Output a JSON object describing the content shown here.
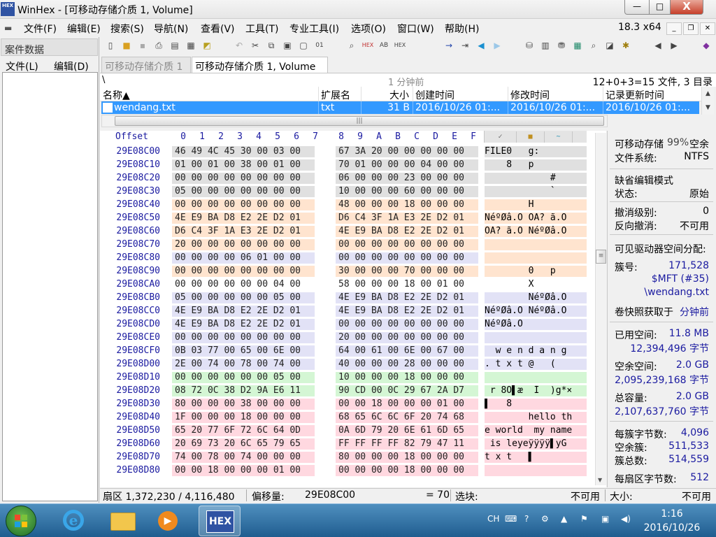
{
  "window": {
    "title": "WinHex - [可移动存储介质 1, Volume]",
    "app_logo": "HEX",
    "btn_min": "—",
    "btn_max": "□",
    "btn_close": "X"
  },
  "menu": {
    "items": [
      "文件(F)",
      "编辑(E)",
      "搜索(S)",
      "导航(N)",
      "查看(V)",
      "工具(T)",
      "专业工具(I)",
      "选项(O)",
      "窗口(W)",
      "帮助(H)"
    ],
    "version": "18.3 x64",
    "mdi_min": "_",
    "mdi_restore": "❐",
    "mdi_close": "✕"
  },
  "case_panel": {
    "title": "案件数据",
    "menu_file": "文件(L)",
    "menu_edit": "编辑(D)"
  },
  "tabs": [
    {
      "label": "可移动存储介质 1"
    },
    {
      "label": "可移动存储介质 1, Volume"
    }
  ],
  "pathbar": {
    "path": "\\",
    "time": "1 分钟前",
    "stats": "12+0+3=15 文件, 3 目录"
  },
  "file_columns": [
    "名称▲",
    "扩展名",
    "大小",
    "创建时间",
    "修改时间",
    "记录更新时间"
  ],
  "file_rows": [
    {
      "name": "wendang.txt",
      "ext": "txt",
      "size": "31 B",
      "created": "2016/10/26  01:...",
      "modified": "2016/10/26  01:...",
      "record_updated": "2016/10/26  01:..."
    }
  ],
  "hex_header": {
    "offset_label": "Offset",
    "columns": [
      "0",
      "1",
      "2",
      "3",
      "4",
      "5",
      "6",
      "7",
      "8",
      "9",
      "A",
      "B",
      "C",
      "D",
      "E",
      "F"
    ]
  },
  "hex_rows": [
    {
      "offset": "29E08C00",
      "a": "46 49 4C 45 30 00 03 00",
      "b": "67 3A 20 00 00 00 00 00",
      "text": "FILE0   g:      "
    },
    {
      "offset": "29E08C10",
      "a": "01 00 01 00 38 00 01 00",
      "b": "70 01 00 00 00 04 00 00",
      "text": "    8   p       "
    },
    {
      "offset": "29E08C20",
      "a": "00 00 00 00 00 00 00 00",
      "b": "06 00 00 00 23 00 00 00",
      "text": "            #   "
    },
    {
      "offset": "29E08C30",
      "a": "05 00 00 00 00 00 00 00",
      "b": "10 00 00 00 60 00 00 00",
      "text": "            `   "
    },
    {
      "offset": "29E08C40",
      "a": "00 00 00 00 00 00 00 00",
      "b": "48 00 00 00 18 00 00 00",
      "text": "        H       "
    },
    {
      "offset": "29E08C50",
      "a": "4E E9 BA D8 E2 2E D2 01",
      "b": "D6 C4 3F 1A E3 2E D2 01",
      "text": "NéºØâ.Ò ÖÄ? ã.Ò "
    },
    {
      "offset": "29E08C60",
      "a": "D6 C4 3F 1A E3 2E D2 01",
      "b": "4E E9 BA D8 E2 2E D2 01",
      "text": "ÖÄ? ã.Ò NéºØâ.Ò "
    },
    {
      "offset": "29E08C70",
      "a": "20 00 00 00 00 00 00 00",
      "b": "00 00 00 00 00 00 00 00",
      "text": "                "
    },
    {
      "offset": "29E08C80",
      "a": "00 00 00 00 06 01 00 00",
      "b": "00 00 00 00 00 00 00 00",
      "text": "                "
    },
    {
      "offset": "29E08C90",
      "a": "00 00 00 00 00 00 00 00",
      "b": "30 00 00 00 70 00 00 00",
      "text": "        0   p   "
    },
    {
      "offset": "29E08CA0",
      "a": "00 00 00 00 00 00 04 00",
      "b": "58 00 00 00 18 00 01 00",
      "text": "        X       "
    },
    {
      "offset": "29E08CB0",
      "a": "05 00 00 00 00 00 05 00",
      "b": "4E E9 BA D8 E2 2E D2 01",
      "text": "        NéºØâ.Ò "
    },
    {
      "offset": "29E08CC0",
      "a": "4E E9 BA D8 E2 2E D2 01",
      "b": "4E E9 BA D8 E2 2E D2 01",
      "text": "NéºØâ.Ò NéºØâ.Ò "
    },
    {
      "offset": "29E08CD0",
      "a": "4E E9 BA D8 E2 2E D2 01",
      "b": "00 00 00 00 00 00 00 00",
      "text": "NéºØâ.Ò         "
    },
    {
      "offset": "29E08CE0",
      "a": "00 00 00 00 00 00 00 00",
      "b": "20 00 00 00 00 00 00 00",
      "text": "                "
    },
    {
      "offset": "29E08CF0",
      "a": "0B 03 77 00 65 00 6E 00",
      "b": "64 00 61 00 6E 00 67 00",
      "text": "  w e n d a n g "
    },
    {
      "offset": "29E08D00",
      "a": "2E 00 74 00 78 00 74 00",
      "b": "40 00 00 00 28 00 00 00",
      "text": ". t x t @   (   "
    },
    {
      "offset": "29E08D10",
      "a": "00 00 00 00 00 00 05 00",
      "b": "10 00 00 00 18 00 00 00",
      "text": "                "
    },
    {
      "offset": "29E08D20",
      "a": "08 72 0C 38 D2 9A E6 11",
      "b": "90 CD 00 0C 29 67 2A D7",
      "text": " r 8Ò▌æ  Í  )g*×"
    },
    {
      "offset": "29E08D30",
      "a": "80 00 00 00 38 00 00 00",
      "b": "00 00 18 00 00 00 01 00",
      "text": "▌   8           "
    },
    {
      "offset": "29E08D40",
      "a": "1F 00 00 00 18 00 00 00",
      "b": "68 65 6C 6C 6F 20 74 68",
      "text": "        hello th"
    },
    {
      "offset": "29E08D50",
      "a": "65 20 77 6F 72 6C 64 0D",
      "b": "0A 6D 79 20 6E 61 6D 65",
      "text": "e world  my name"
    },
    {
      "offset": "29E08D60",
      "a": "20 69 73 20 6C 65 79 65",
      "b": "FF FF FF FF 82 79 47 11",
      "text": " is leyeÿÿÿÿ▌yG "
    },
    {
      "offset": "29E08D70",
      "a": "74 00 78 00 74 00 00 00",
      "b": "80 00 00 00 18 00 00 00",
      "text": "t x t   ▌       "
    },
    {
      "offset": "29E08D80",
      "a": "00 00 18 00 00 00 01 00",
      "b": "00 00 00 00 18 00 00 00",
      "text": "                "
    }
  ],
  "info": {
    "media_label": "可移动存储",
    "media_pct": "99%",
    "media_free": "空余",
    "fs_label": "文件系统:",
    "fs_value": "NTFS",
    "edit_mode_label": "缺省编辑模式",
    "state_label": "状态:",
    "state_value": "原始",
    "undo_level_label": "撤消级别:",
    "undo_level_value": "0",
    "reverse_undo_label": "反向撤消:",
    "reverse_undo_value": "不可用",
    "alloc_label": "可见驱动器空间分配:",
    "cluster_label": "簇号:",
    "cluster_value": "171,528",
    "mft_value": "$MFT (#35)",
    "file_value": "\\wendang.txt",
    "snapshot_label": "卷快照获取于",
    "snapshot_value": "分钟前",
    "used_label": "已用空间:",
    "used_value": "11.8 MB",
    "used_bytes": "12,394,496 字节",
    "free_label": "空余空间:",
    "free_value": "2.0 GB",
    "free_bytes": "2,095,239,168 字节",
    "total_label": "总容量:",
    "total_value": "2.0 GB",
    "total_bytes": "2,107,637,760 字节",
    "bpc_label": "每簇字节数:",
    "bpc_value": "4,096",
    "free_clusters_label": "空余簇:",
    "free_clusters_value": "511,533",
    "total_clusters_label": "簇总数:",
    "total_clusters_value": "514,559",
    "bps_label": "每扇区字节数:",
    "bps_value": "512"
  },
  "status": {
    "sector": "扇区 1,372,230 / 4,116,480",
    "offset_label": "偏移量:",
    "offset_value": "29E08C00",
    "value": "= 70",
    "selection_label": "选块:",
    "selection_value": "不可用",
    "size_label": "大小:",
    "size_value": "不可用"
  },
  "taskbar": {
    "ime": "CH",
    "time": "1:16",
    "date": "2016/10/26",
    "winhex_label": "HEX"
  },
  "colors": {
    "selection": "#3399ff",
    "offset_text": "#1a1aa0"
  }
}
